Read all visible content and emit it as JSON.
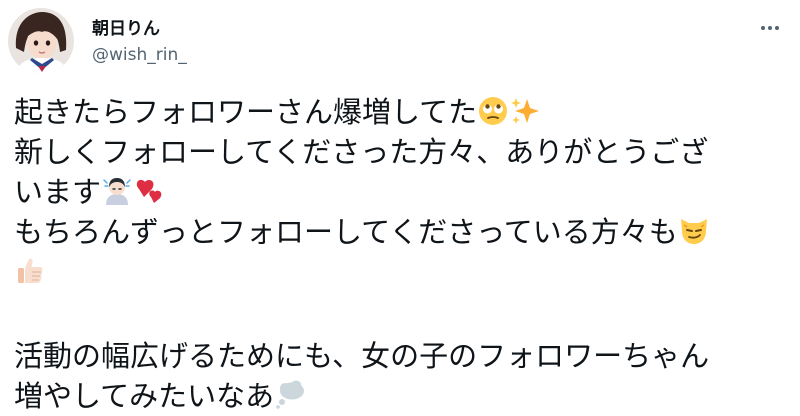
{
  "author": {
    "display_name": "朝日りん",
    "handle": "@wish_rin_"
  },
  "tweet": {
    "line1": "起きたらフォロワーさん爆増してた",
    "line2": "新しくフォローしてくださった方々、ありがとうござ",
    "line3": "います",
    "line4": "もちろんずっとフォローしてくださっている方々も",
    "line5": "活動の幅広げるためにも、女の子のフォロワーちゃん",
    "line6": "増やしてみたいなあ"
  },
  "icons": {
    "more": "more-horizontal-icon",
    "emoji_1": "face-with-rolling-eyes",
    "emoji_2": "sparkles",
    "emoji_3": "person-bowing",
    "emoji_4": "two-hearts",
    "emoji_5": "smirking-cat",
    "emoji_6": "thumbs-up",
    "emoji_7": "thought-balloon"
  },
  "colors": {
    "text": "#0f1419",
    "secondary": "#536471",
    "background": "#ffffff"
  }
}
